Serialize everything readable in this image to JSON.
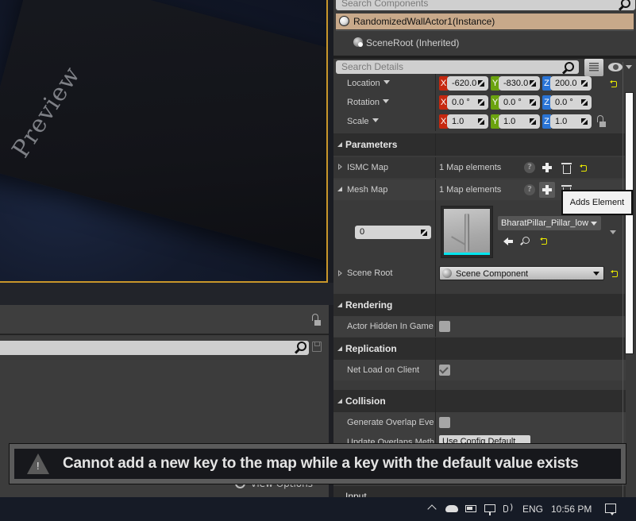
{
  "viewport": {
    "overlay_text": "Preview",
    "selection_border_color": "#c8962a"
  },
  "left_panel": {
    "search": {
      "value": "",
      "placeholder": ""
    },
    "view_options_label": "View Options"
  },
  "components": {
    "search_placeholder": "Search Components",
    "items": [
      {
        "label": "RandomizedWallActor1(Instance)",
        "selected": true
      },
      {
        "label": "SceneRoot (Inherited)",
        "selected": false
      }
    ]
  },
  "details": {
    "search_placeholder": "Search Details",
    "transform": {
      "location": {
        "label": "Location",
        "x": "-620.0",
        "y": "-830.0",
        "z": "200.0"
      },
      "rotation": {
        "label": "Rotation",
        "x": "0.0 °",
        "y": "0.0 °",
        "z": "0.0 °"
      },
      "scale": {
        "label": "Scale",
        "x": "1.0",
        "y": "1.0",
        "z": "1.0"
      }
    },
    "axis_labels": {
      "x": "X",
      "y": "Y",
      "z": "Z"
    },
    "axis_colors": {
      "x": "#c6280f",
      "y": "#6ba30f",
      "z": "#2a74d5"
    },
    "categories": {
      "parameters": "Parameters",
      "rendering": "Rendering",
      "replication": "Replication",
      "collision": "Collision",
      "input": "Input"
    },
    "parameters": {
      "ismc_map": {
        "label": "ISMC Map",
        "value": "1 Map elements"
      },
      "mesh_map": {
        "label": "Mesh Map",
        "value": "1 Map elements"
      },
      "mesh_entry": {
        "key": "0",
        "mesh": "BharatPillar_Pillar_low"
      },
      "scene_root": {
        "label": "Scene Root",
        "value": "Scene Component"
      }
    },
    "rendering": {
      "actor_hidden_in_game": {
        "label": "Actor Hidden In Game",
        "checked": false
      }
    },
    "replication": {
      "net_load_on_client": {
        "label": "Net Load on Client",
        "checked": true
      }
    },
    "collision": {
      "generate_overlap": {
        "label": "Generate Overlap Events",
        "label_visible": "Generate Overlap Ever",
        "checked": false
      },
      "update_overlaps": {
        "label_visible": "Update Overlaps Meth",
        "value": "Use Config Default"
      }
    },
    "help_glyph": "?"
  },
  "tooltip": {
    "text": "Adds Element"
  },
  "notification": {
    "message": "Cannot add a new key to the map while a key with the default value exists",
    "icon": "warning-icon"
  },
  "taskbar": {
    "language": "ENG",
    "time": "10:56 PM"
  }
}
